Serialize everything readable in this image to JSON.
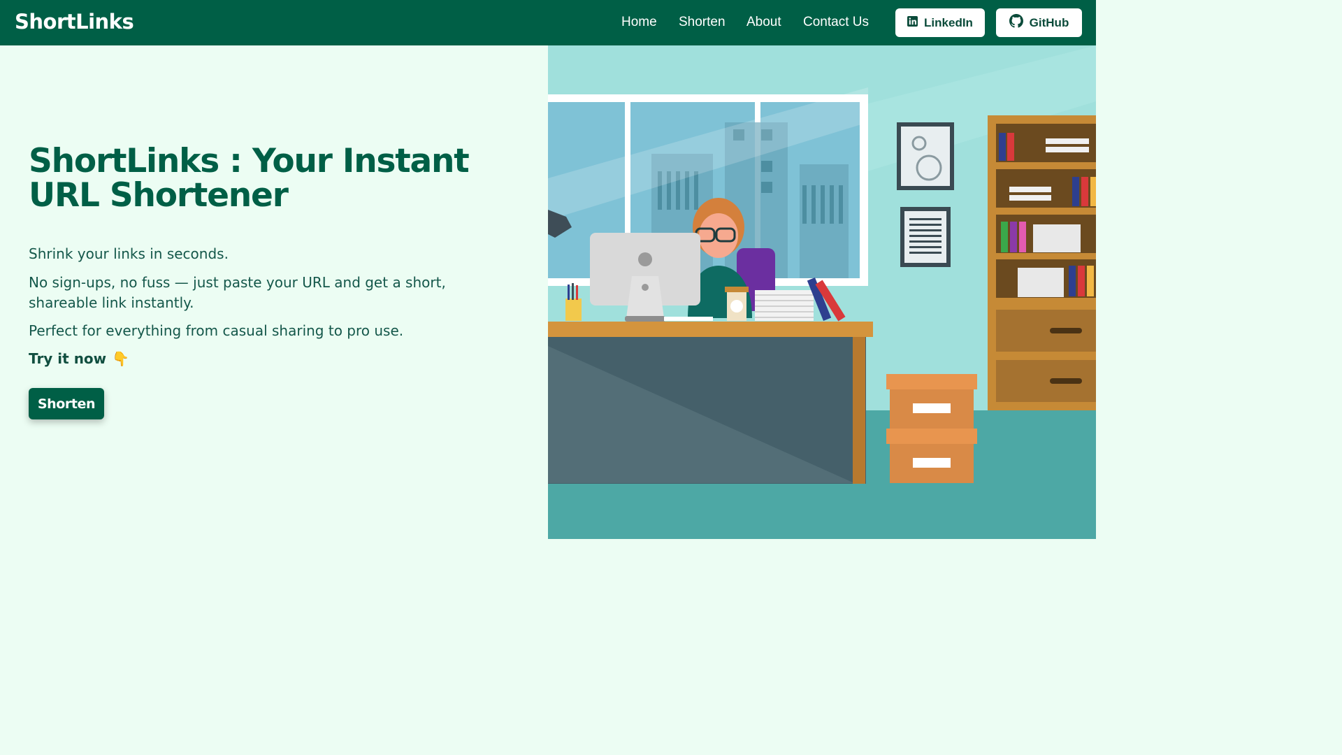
{
  "navbar": {
    "brand": "ShortLinks",
    "links": [
      "Home",
      "Shorten",
      "About",
      "Contact Us"
    ],
    "linkedin_label": "LinkedIn",
    "github_label": "GitHub"
  },
  "hero": {
    "title": "ShortLinks : Your Instant URL Shortener",
    "p1": "Shrink your links in seconds.",
    "p2": "No sign-ups, no fuss — just paste your URL and get a short, shareable link instantly.",
    "p3": "Perfect for everything from casual sharing to pro use.",
    "try_label": "Try it now",
    "try_emoji": "👇",
    "cta_label": "Shorten"
  },
  "colors": {
    "primary": "#005f46",
    "background": "#ecfdf3",
    "illustration_bg": "#a0e0dc"
  },
  "icons": {
    "linkedin": "linkedin-icon",
    "github": "github-icon"
  }
}
